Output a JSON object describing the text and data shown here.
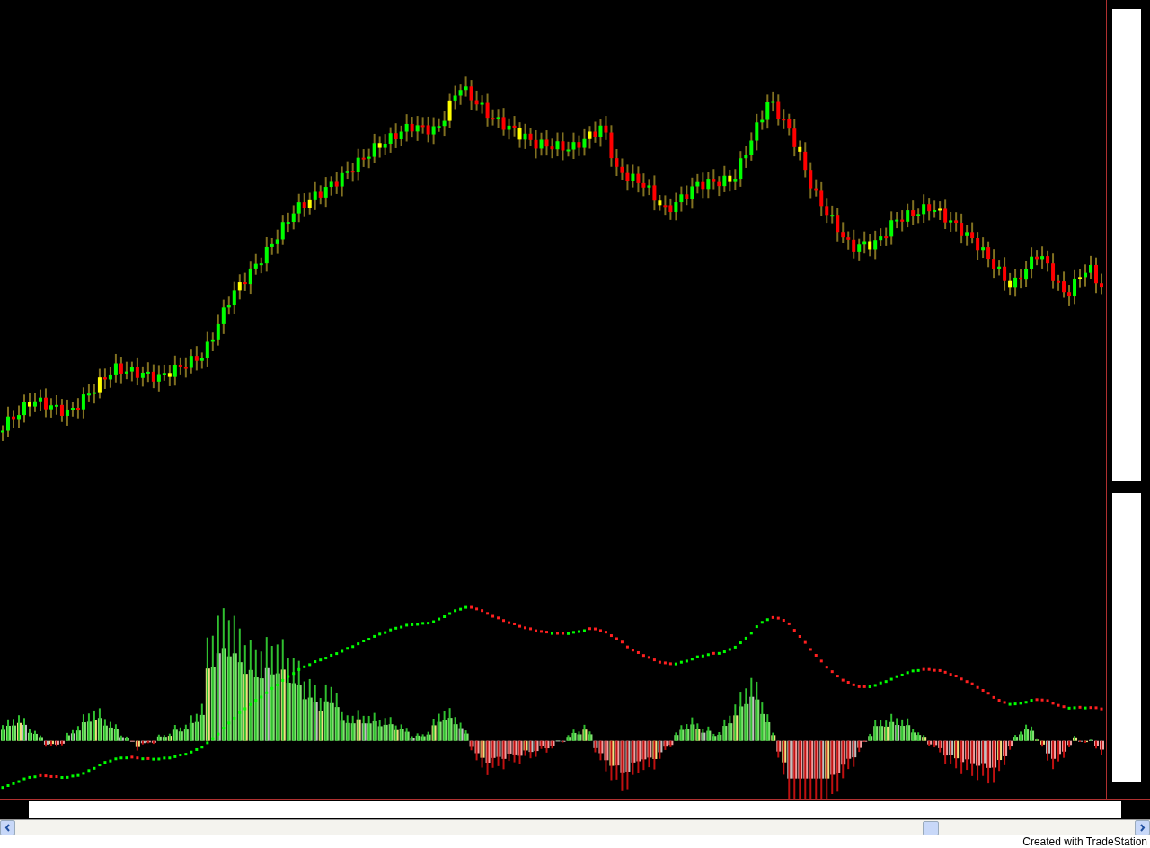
{
  "footer": {
    "credit": "Created with TradeStation"
  }
}
